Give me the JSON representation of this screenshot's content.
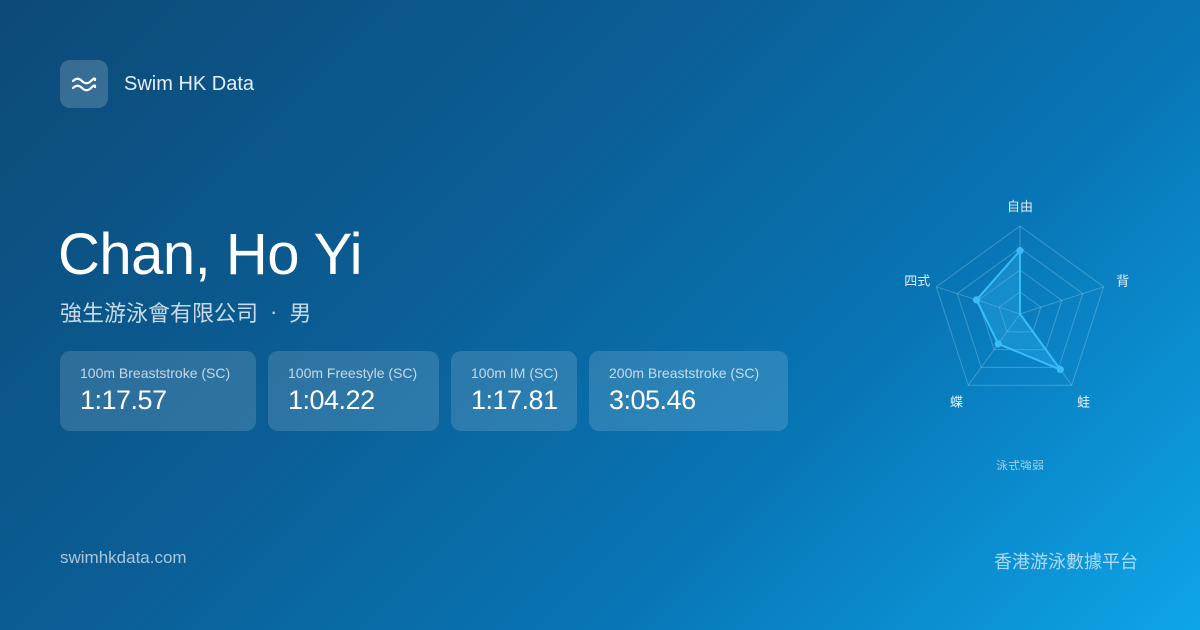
{
  "brand": {
    "name": "Swim HK Data",
    "logo_icon": "waves-icon"
  },
  "swimmer": {
    "name": "Chan, Ho Yi",
    "club": "強生游泳會有限公司",
    "separator": "·",
    "gender": "男"
  },
  "best_times": [
    {
      "event": "100m Breaststroke",
      "course": "(SC)",
      "time": "1:17.57"
    },
    {
      "event": "100m Freestyle",
      "course": "(SC)",
      "time": "1:04.22"
    },
    {
      "event": "100m IM",
      "course": "(SC)",
      "time": "1:17.81"
    },
    {
      "event": "200m Breaststroke",
      "course": "(SC)",
      "time": "3:05.46"
    }
  ],
  "footer": {
    "url": "swimhkdata.com",
    "tagline": "香港游泳數據平台"
  },
  "chart_data": {
    "type": "radar",
    "title": "泳式強弱",
    "axes": [
      "自由",
      "背",
      "蛙",
      "蝶",
      "四式"
    ],
    "values": [
      0.72,
      0.0,
      0.78,
      0.42,
      0.52
    ],
    "range": [
      0,
      1
    ],
    "rings": 4,
    "color": "#38bdf8"
  }
}
